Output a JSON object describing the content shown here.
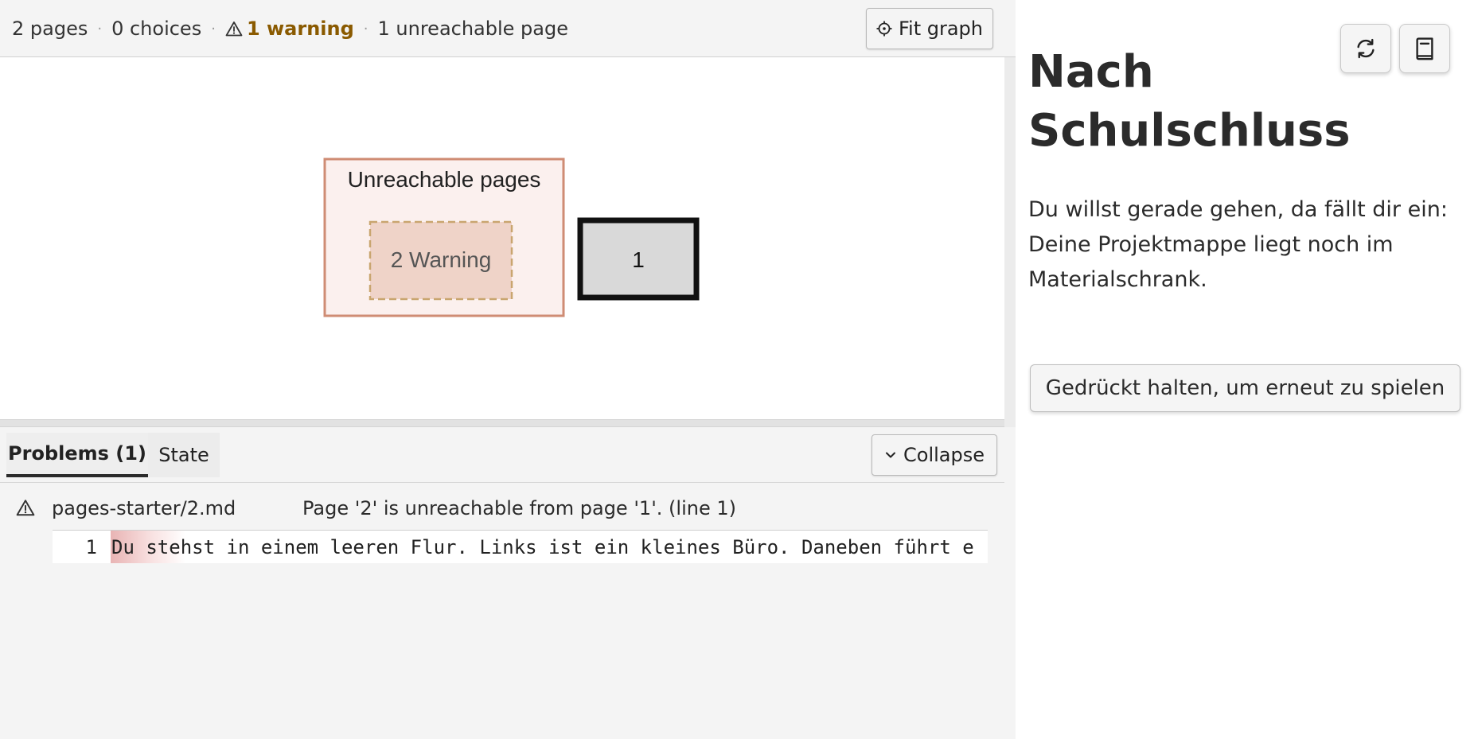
{
  "statusbar": {
    "pages": "2 pages",
    "choices": "0 choices",
    "warnings": "1 warning",
    "unreachable": "1 unreachable page",
    "separator": "·",
    "fit_graph_label": "Fit graph"
  },
  "graph": {
    "group_label": "Unreachable pages",
    "unreachable_node_label": "2 Warning",
    "start_node_label": "1"
  },
  "bottom_panel": {
    "tabs": [
      {
        "label": "Problems (1)",
        "active": true
      },
      {
        "label": "State",
        "active": false
      }
    ],
    "collapse_label": "Collapse",
    "problems": [
      {
        "file": "pages-starter/2.md",
        "message": "Page '2' is unreachable from page '1'. (line 1)",
        "snippet_line_number": "1",
        "snippet_text": "Du stehst in einem leeren Flur. Links ist ein kleines Büro. Daneben führt e"
      }
    ]
  },
  "preview": {
    "title": "Nach Schulschluss",
    "text": "Du willst gerade gehen, da fällt dir ein: Deine Projektmappe liegt noch im Materialschrank.",
    "replay_label": "Gedrückt halten, um erneut zu spielen"
  },
  "icons": {
    "fit_graph": "crosshair-icon",
    "warning": "warning-triangle-icon",
    "collapse": "chevron-down-icon",
    "reload": "reload-icon",
    "book": "book-icon"
  },
  "colors": {
    "warning_text": "#8a5a00",
    "unreachable_group_fill": "#fbf0ee",
    "unreachable_group_stroke": "#cf8c74",
    "unreachable_node_fill": "#efd3c8",
    "unreachable_node_stroke": "#c9a56f",
    "start_node_fill": "#d9d9d9",
    "start_node_stroke": "#111111"
  }
}
